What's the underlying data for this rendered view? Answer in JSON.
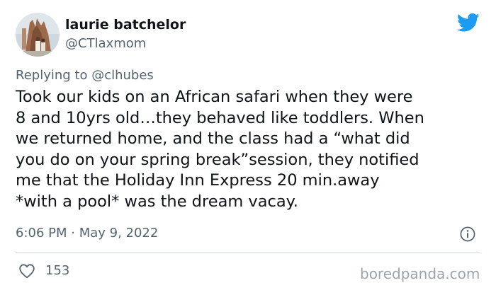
{
  "author": {
    "display_name": "laurie batchelor",
    "handle": "@CTlaxmom"
  },
  "reply": {
    "prefix": "Replying to ",
    "mention": "@clhubes"
  },
  "tweet": {
    "lines": [
      "Took our kids on an African safari when they were",
      "8 and 10yrs old…they behaved like toddlers. When",
      "we returned home, and the class had a “what did",
      "you do on your spring break”session, they notified",
      "me that the Holiday Inn Express 20 min.away",
      "*with a pool* was the dream vacay."
    ],
    "timestamp": "6:06 PM · May 9, 2022"
  },
  "stats": {
    "likes": "153"
  },
  "watermark": "boredpanda.com",
  "colors": {
    "twitter_blue": "#1d9bf0",
    "secondary_text": "#536471",
    "divider": "#cfd9de"
  },
  "icons": {
    "logo": "twitter-bird-icon",
    "info": "info-icon",
    "like": "heart-icon"
  }
}
